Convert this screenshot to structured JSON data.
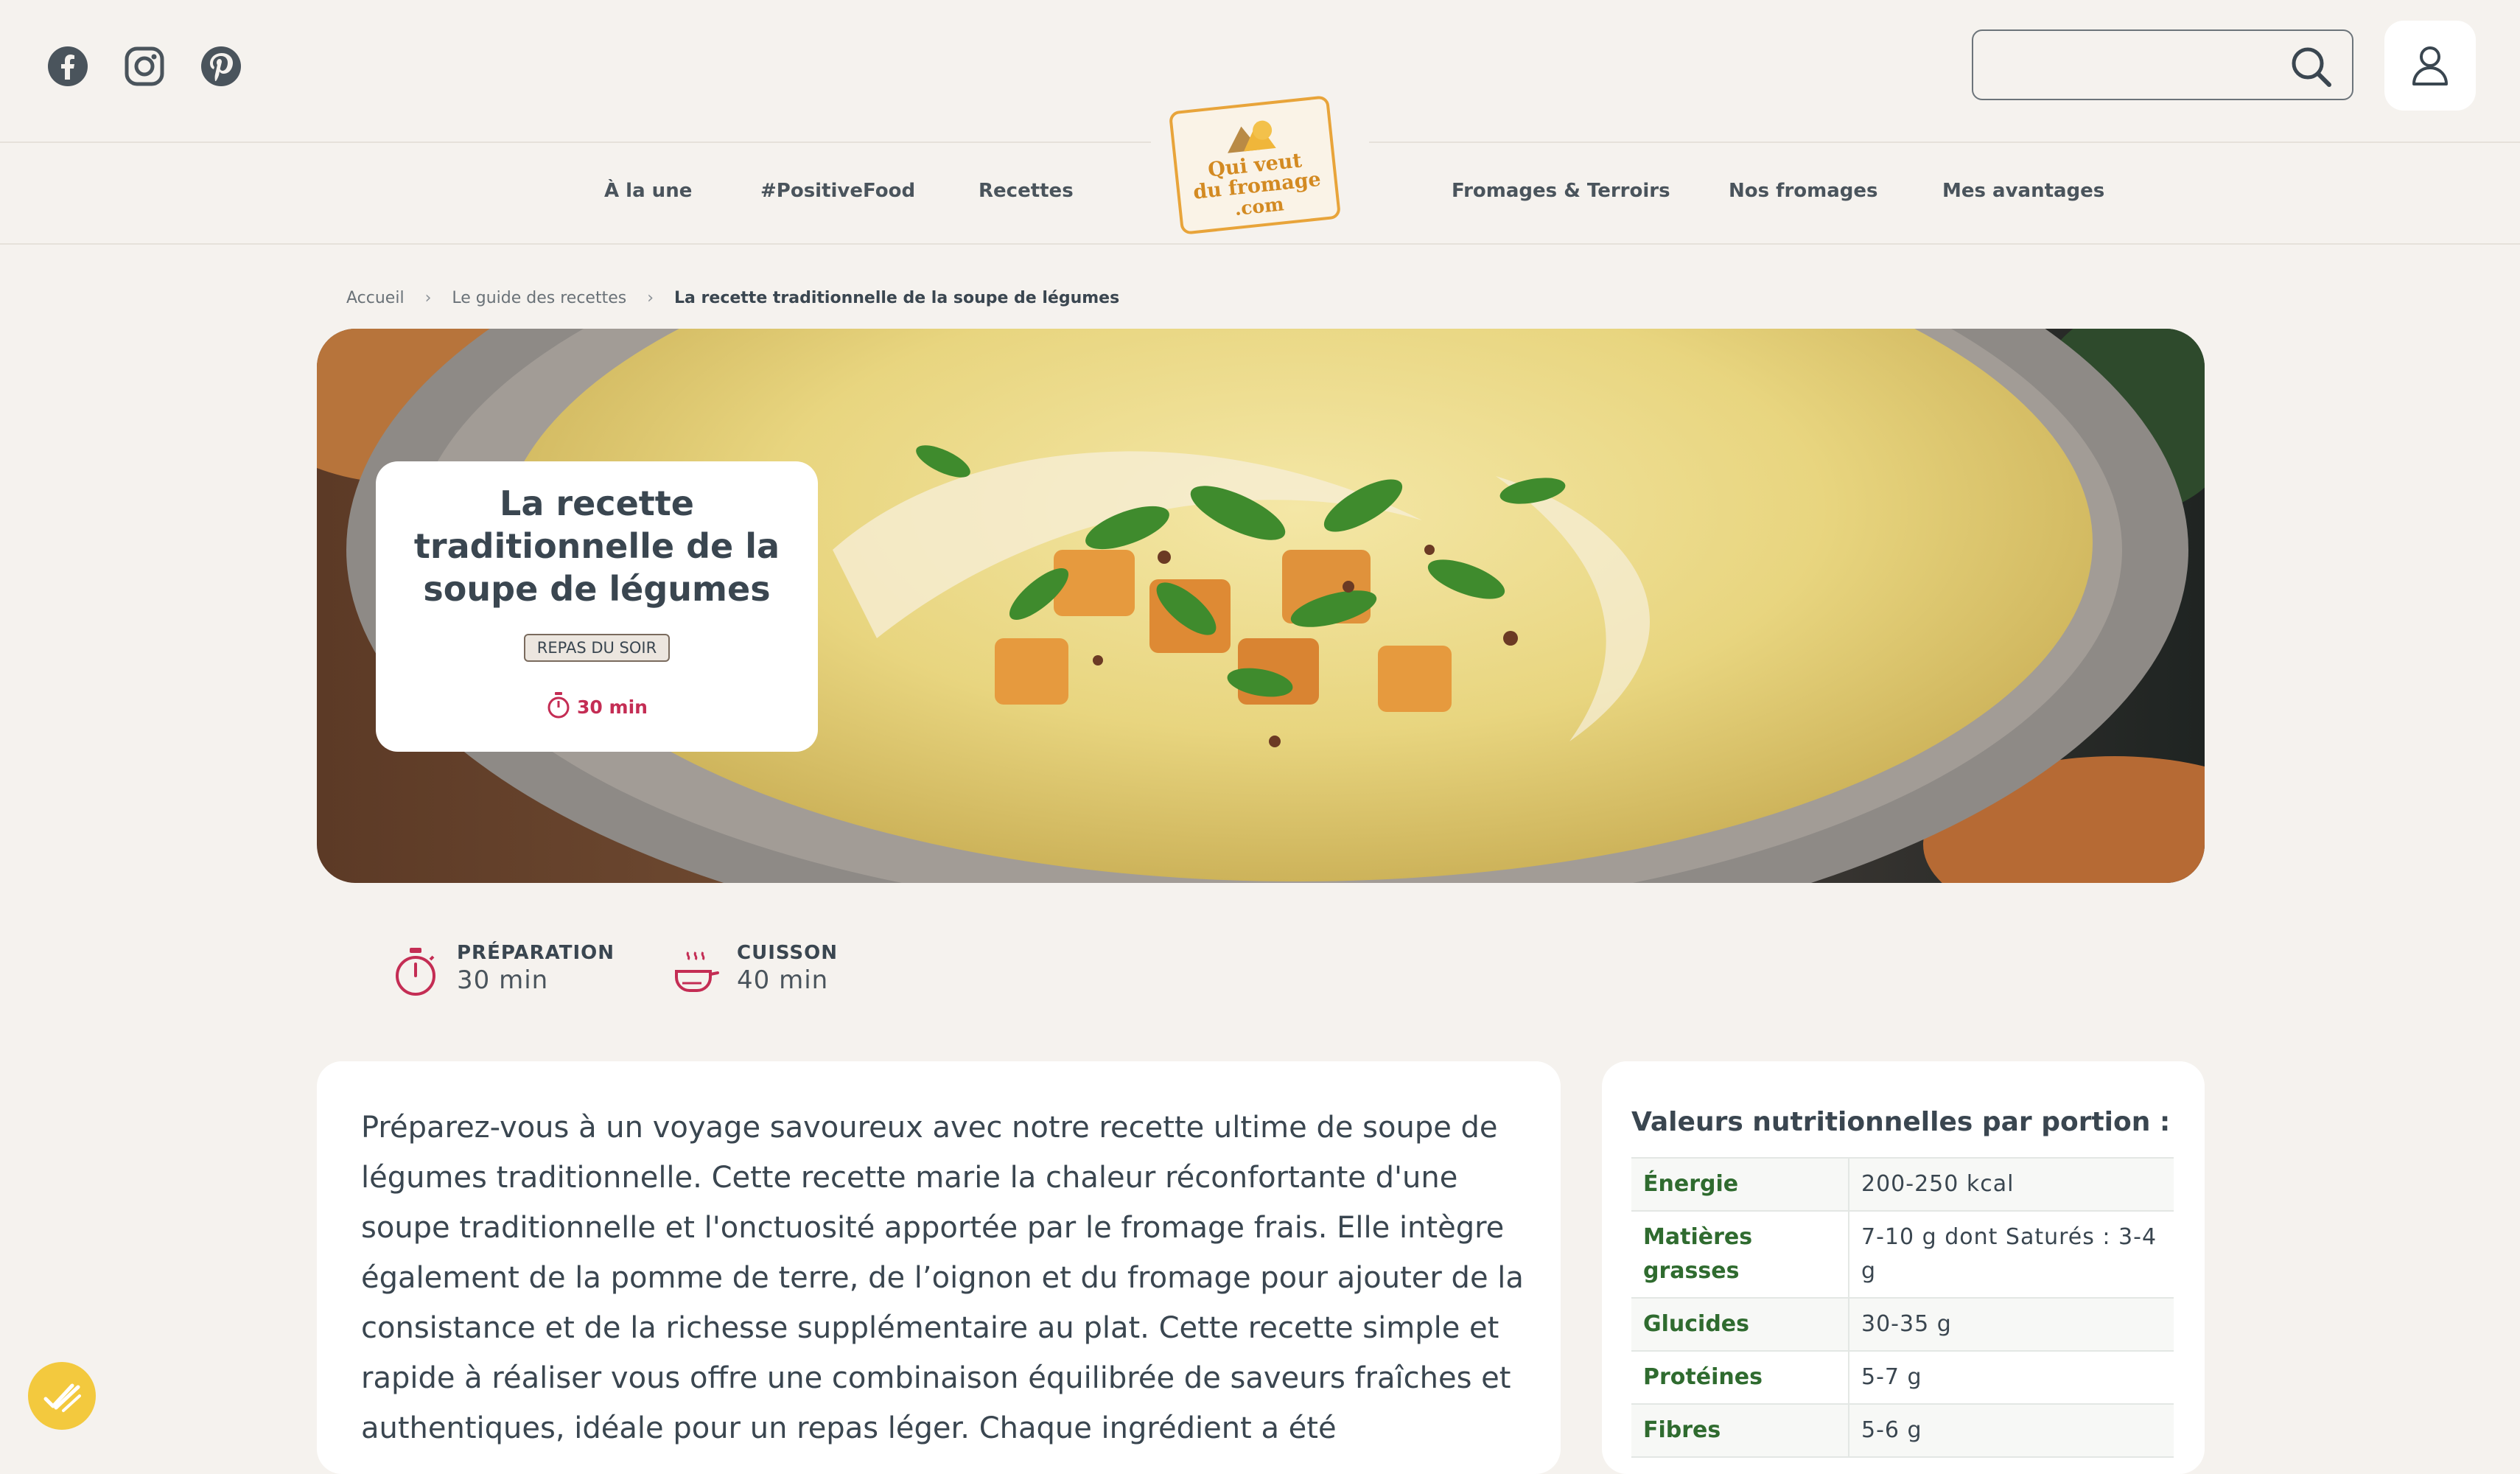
{
  "header": {
    "social": [
      {
        "icon": "facebook-icon"
      },
      {
        "icon": "instagram-icon"
      },
      {
        "icon": "pinterest-icon"
      }
    ],
    "search": {
      "value": "",
      "placeholder": ""
    },
    "account_icon": "user-icon"
  },
  "nav": {
    "items_left": [
      "À la une",
      "#PositiveFood",
      "Recettes"
    ],
    "items_right": [
      "Fromages & Terroirs",
      "Nos fromages",
      "Mes avantages"
    ],
    "logo": {
      "line1": "Qui veut",
      "line2": "du fromage",
      "line3": ".com"
    }
  },
  "breadcrumb": [
    "Accueil",
    "Le guide des recettes",
    "La recette traditionnelle de la soupe de légumes"
  ],
  "hero": {
    "title": "La recette traditionnelle de la soupe de légumes",
    "tag": "REPAS DU SOIR",
    "time": "30 min"
  },
  "meta": {
    "prep": {
      "label": "PRÉPARATION",
      "value": "30 min"
    },
    "cook": {
      "label": "CUISSON",
      "value": "40 min"
    }
  },
  "intro": "Préparez-vous à un voyage savoureux avec notre recette ultime de soupe de légumes traditionnelle. Cette recette marie la chaleur réconfortante d'une soupe traditionnelle et l'onctuosité apportée par le fromage frais. Elle intègre également de la pomme de terre, de l’oignon et du fromage pour ajouter de la consistance et de la richesse supplémentaire au plat. Cette recette simple et rapide à réaliser vous offre une combinaison équilibrée de saveurs fraîches et authentiques, idéale pour un repas léger. Chaque ingrédient a été",
  "nutrition": {
    "title": "Valeurs nutritionnelles par portion :",
    "rows": [
      {
        "key": "Énergie",
        "value": "200-250 kcal"
      },
      {
        "key": "Matières grasses",
        "value": "7-10 g dont Saturés : 3-4 g"
      },
      {
        "key": "Glucides",
        "value": "30-35 g"
      },
      {
        "key": "Protéines",
        "value": "5-7 g"
      },
      {
        "key": "Fibres",
        "value": "5-6 g"
      }
    ]
  },
  "colors": {
    "background": "#f5f2ee",
    "accent_red": "#c42d54",
    "nutrition_green": "#2f6b2f",
    "logo_orange": "#d38a22",
    "badge_yellow": "#f3c93e"
  }
}
